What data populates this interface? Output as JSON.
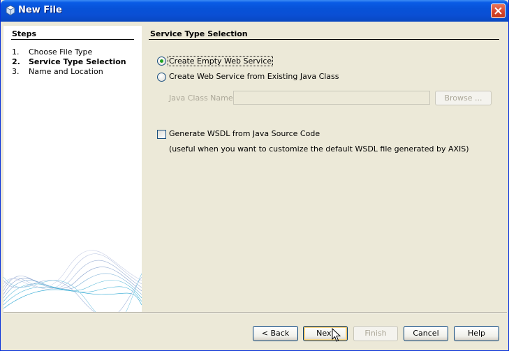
{
  "window": {
    "title": "New File"
  },
  "steps": {
    "heading": "Steps",
    "items": [
      {
        "num": "1.",
        "label": "Choose File Type"
      },
      {
        "num": "2.",
        "label": "Service Type Selection"
      },
      {
        "num": "3.",
        "label": "Name and Location"
      }
    ]
  },
  "main": {
    "title": "Service Type Selection",
    "option_empty": "Create Empty Web Service",
    "option_existing": "Create Web Service from Existing Java Class",
    "java_class_label": "Java Class Name:",
    "java_class_value": "",
    "browse_label": "Browse ...",
    "generate_wsdl_label": "Generate WSDL from Java Source Code",
    "generate_wsdl_hint": "(useful when you want to customize the default WSDL file generated by AXIS)"
  },
  "buttons": {
    "back": "< Back",
    "next": "Next",
    "finish": "Finish",
    "cancel": "Cancel",
    "help": "Help"
  },
  "colors": {
    "accent": "#0a5ce6",
    "radio_selected": "#21a121"
  }
}
